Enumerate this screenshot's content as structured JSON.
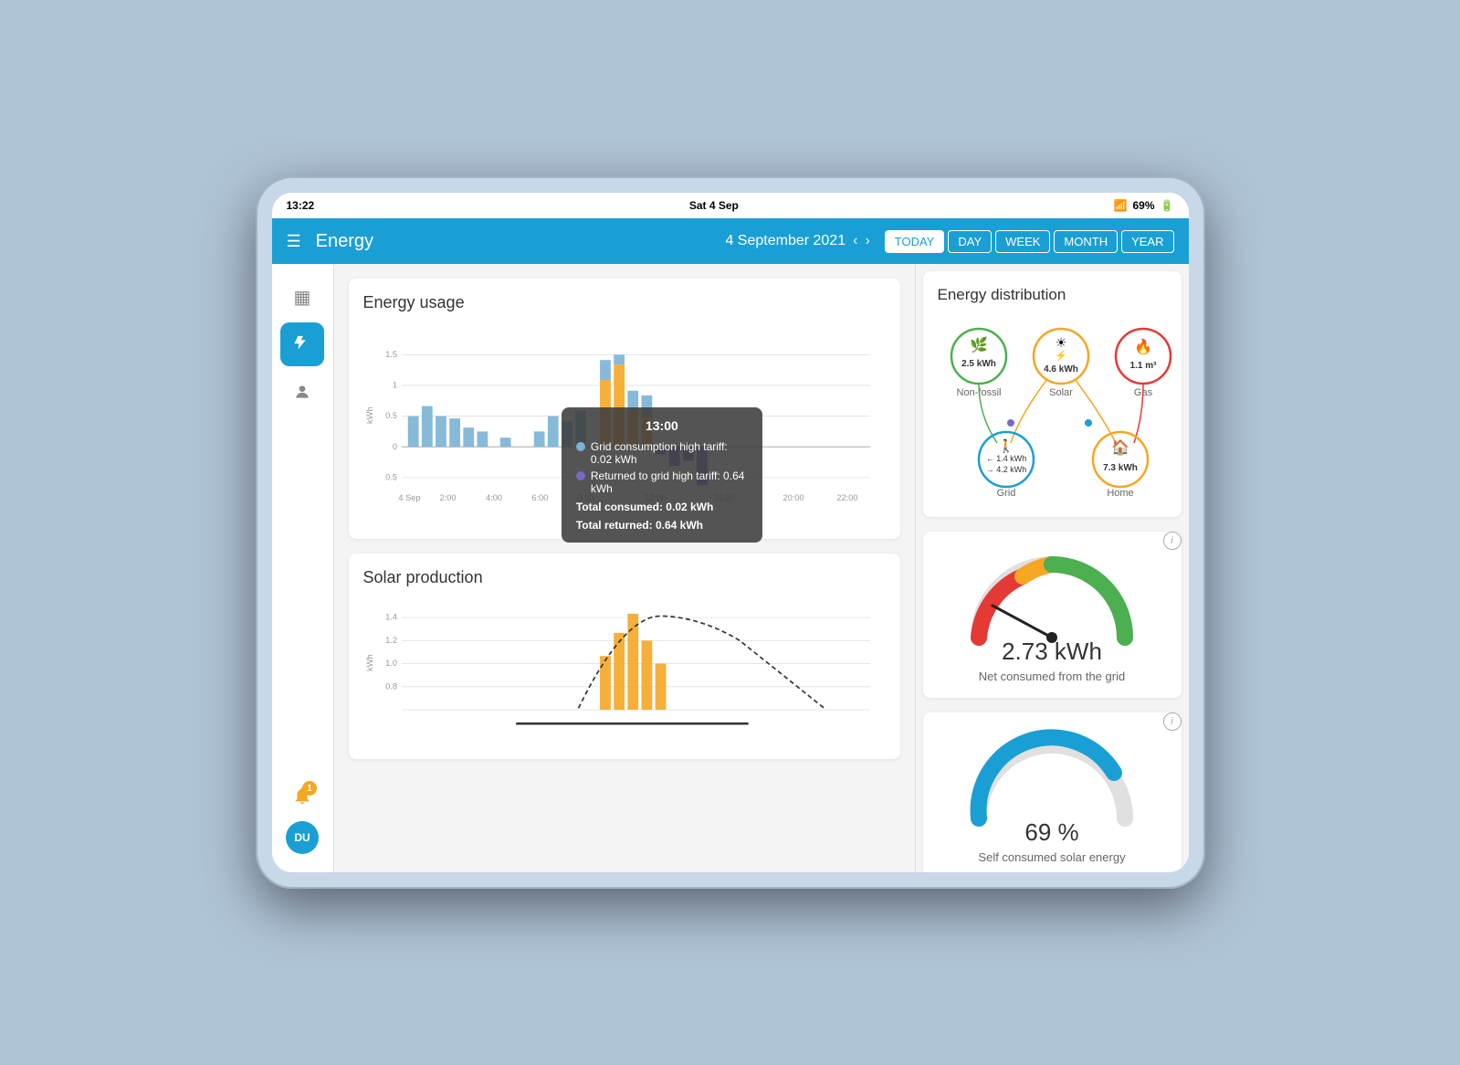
{
  "statusBar": {
    "time": "13:22",
    "date": "Sat 4 Sep",
    "battery": "69%"
  },
  "topNav": {
    "title": "Energy",
    "date": "4 September 2021",
    "buttons": [
      "TODAY",
      "DAY",
      "WEEK",
      "MONTH",
      "YEAR"
    ],
    "activeButton": "TODAY"
  },
  "sidebar": {
    "items": [
      {
        "name": "grid-icon",
        "icon": "▦",
        "active": false
      },
      {
        "name": "lightning-icon",
        "icon": "⚡",
        "active": true
      },
      {
        "name": "person-icon",
        "icon": "👤",
        "active": false
      }
    ],
    "notification": {
      "count": "1"
    },
    "avatar": {
      "initials": "DU"
    }
  },
  "energyUsage": {
    "title": "Energy usage",
    "yAxisLabel": "kWh",
    "xLabels": [
      "4 Sep",
      "2:00",
      "4:00",
      "6:00",
      "8:00",
      "",
      "12:00",
      "",
      "16:00",
      "",
      "20:00",
      "",
      "22:00"
    ]
  },
  "tooltip": {
    "time": "13:00",
    "rows": [
      {
        "color": "#7ab3d4",
        "label": "Grid consumption high tariff: 0.02 kWh"
      },
      {
        "color": "#7b68c8",
        "label": "Returned to grid high tariff: 0.64 kWh"
      }
    ],
    "totalConsumed": "Total consumed: 0.02 kWh",
    "totalReturned": "Total returned: 0.64 kWh"
  },
  "solarProduction": {
    "title": "Solar production",
    "yAxisLabel": "kWh",
    "yMax": "1.4",
    "yMid": "1.2",
    "y1": "1.0",
    "y08": "0.8"
  },
  "energyDistribution": {
    "title": "Energy distribution",
    "nodes": {
      "top": [
        {
          "id": "non-fossil",
          "label": "Non-fossil",
          "value": "2.5 kWh",
          "color": "#4caf50",
          "icon": "🌿"
        },
        {
          "id": "solar",
          "label": "Solar",
          "value": "4.6 kWh",
          "color": "#f5a623",
          "icon": "☀"
        },
        {
          "id": "gas",
          "label": "Gas",
          "value": "1.1 m³",
          "color": "#e53935",
          "icon": "🔥"
        }
      ],
      "bottom": [
        {
          "id": "grid",
          "label": "Grid",
          "value1": "← 1.4 kWh",
          "value2": "→ 4.2 kWh",
          "color": "#1a9fd4",
          "icon": "🚶"
        },
        {
          "id": "home",
          "label": "Home",
          "value": "7.3 kWh",
          "color": "#f5a623",
          "icon": "🏠"
        }
      ]
    }
  },
  "netConsumed": {
    "value": "2.73 kWh",
    "label": "Net consumed from the grid"
  },
  "selfConsumed": {
    "value": "69 %",
    "label": "Self consumed solar energy"
  }
}
